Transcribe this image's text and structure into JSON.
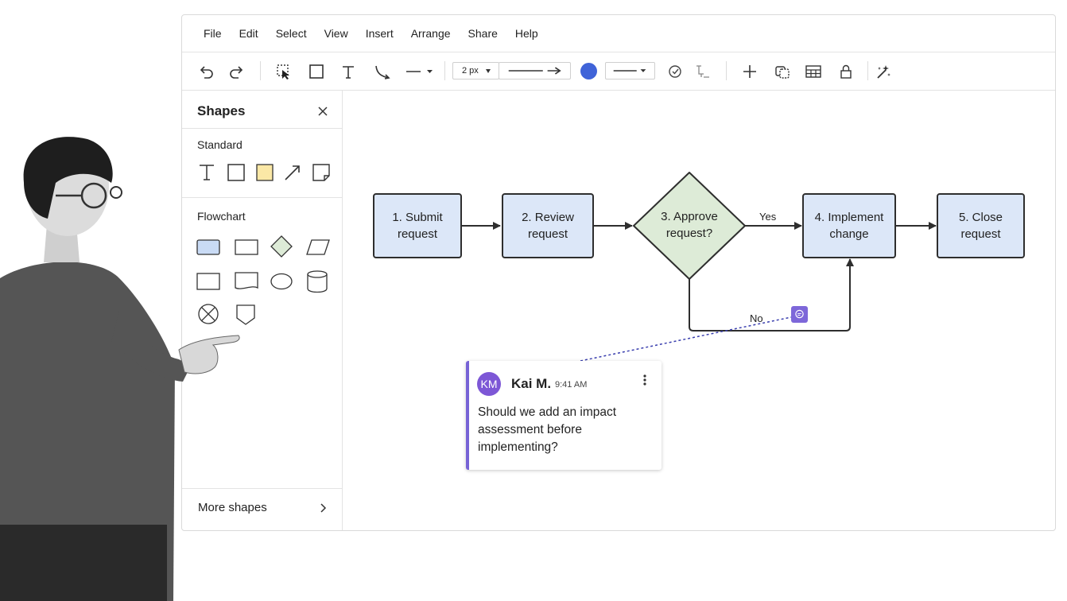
{
  "menu": [
    "File",
    "Edit",
    "Select",
    "View",
    "Insert",
    "Arrange",
    "Share",
    "Help"
  ],
  "toolbar": {
    "icons": [
      "undo-icon",
      "redo-icon",
      "pointer-icon",
      "rectangle-icon",
      "text-icon",
      "connector-icon",
      "line-style-icon",
      "line-end-icon",
      "fill-color",
      "border-style-icon",
      "style-icon",
      "tree-icon",
      "add-icon",
      "group-icon",
      "table-icon",
      "lock-icon",
      "magic-icon"
    ],
    "stroke_width": "2 px",
    "fill_color": "#3f63d8"
  },
  "shapes_panel": {
    "title": "Shapes",
    "standard_label": "Standard",
    "flowchart_label": "Flowchart",
    "more_shapes": "More shapes",
    "standard_icons": [
      "text-shape-icon",
      "rectangle-shape-icon",
      "sticky-note-icon",
      "arrow-shape-icon",
      "note-shape-icon"
    ],
    "flowchart_icons": [
      "process-icon",
      "rect-icon",
      "decision-icon",
      "data-icon",
      "box-icon",
      "document-icon",
      "ellipse-icon",
      "database-icon",
      "or-icon",
      "offpage-icon"
    ]
  },
  "diagram": {
    "nodes": {
      "n1": "1. Submit request",
      "n2": "2. Review request",
      "n3": "3. Approve request?",
      "n4": "4. Implement change",
      "n5": "5. Close request"
    },
    "labels": {
      "yes": "Yes",
      "no": "No"
    },
    "node_fill": "#dce7f8",
    "decision_fill": "#ddebd7"
  },
  "comment": {
    "initials": "KM",
    "author": "Kai M.",
    "time": "9:41 AM",
    "text": "Should we add an impact assessment before implementing?",
    "accent": "#7763d6"
  }
}
